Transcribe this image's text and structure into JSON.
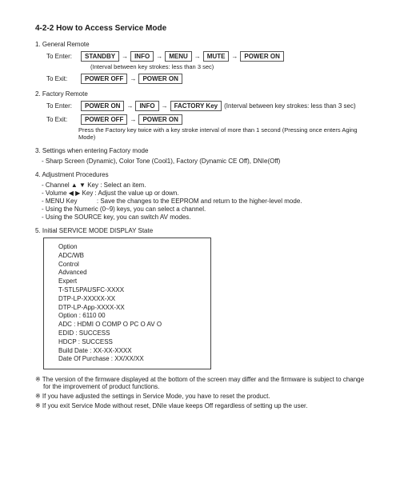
{
  "title": "4-2-2 How to Access Service Mode",
  "sec1": {
    "head": "1. General Remote",
    "enter_label": "To Enter:",
    "exit_label": "To Exit:",
    "keys_enter": {
      "k1": "STANDBY",
      "k2": "INFO",
      "k3": "MENU",
      "k4": "MUTE",
      "k5": "POWER ON"
    },
    "interval": "(Interval between key strokes: less than 3 sec)",
    "keys_exit": {
      "k1": "POWER OFF",
      "k2": "POWER ON"
    }
  },
  "sec2": {
    "head": "2. Factory Remote",
    "enter_label": "To Enter:",
    "exit_label": "To Exit:",
    "keys_enter": {
      "k1": "POWER ON",
      "k2": "INFO",
      "k3": "FACTORY Key"
    },
    "interval_inline": "(Interval between key strokes: less than 3 sec)",
    "keys_exit": {
      "k1": "POWER OFF",
      "k2": "POWER ON"
    },
    "press_note": "Press the Factory key twice with a key stroke interval of more than 1 second (Pressing once enters Aging Mode)"
  },
  "sec3": {
    "head": "3. Settings when entering Factory mode",
    "l1": "- Sharp Screen (Dynamic), Color Tone (Cool1), Factory (Dynamic CE Off), DNIe(Off)"
  },
  "sec4": {
    "head": "4. Adjustment Procedures",
    "l1": "- Channel ▲ ▼ Key : Select an item.",
    "l2": "- Volume  ◀ ▶  Key  : Adjust the value up or down.",
    "l3": "- MENU Key           : Save the changes to the EEPROM and return to the higher-level mode.",
    "l4": "- Using the Numeric (0~9) keys, you can select a channel.",
    "l5": "- Using the SOURCE key, you can switch AV modes."
  },
  "sec5": {
    "head": "5. Initial SERVICE MODE DISPLAY State",
    "box": {
      "l1": "Option",
      "l2": "ADC/WB",
      "l3": "Control",
      "l4": "Advanced",
      "l5": "Expert",
      "l6": "T-STL5PAUSFC-XXXX",
      "l7": "DTP-LP-XXXXX-XX",
      "l8": "DTP-LP-App-XXXX-XX",
      "l9": "Option : 6110 00",
      "l10": "ADC : HDMI O COMP O PC O AV O",
      "l11": "EDID : SUCCESS",
      "l12": "HDCP : SUCCESS",
      "l13": "Build Date : XX-XX-XXXX",
      "l14": "Date Of Purchase : XX/XX/XX"
    }
  },
  "foot": {
    "f1": "※ The version of the firmware displayed at the bottom of the screen may differ and the firmware is subject to change for  the improvement of product functions.",
    "f2": "※ If you have adjusted the settings in Service Mode, you have to reset the product.",
    "f3": "※ If you exit Service Mode without reset, DNIe vlaue keeps Off regardless of setting up the user."
  },
  "arrow": "→"
}
